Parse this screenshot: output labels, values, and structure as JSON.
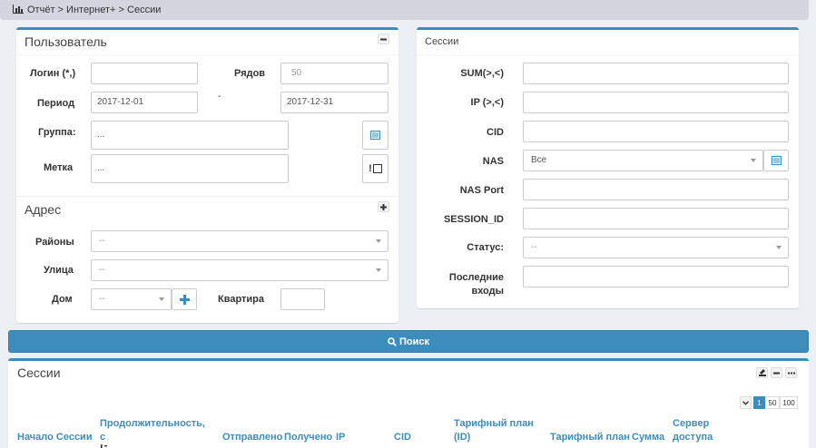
{
  "breadcrumb": {
    "items": [
      "Отчёт",
      "Интернет+",
      "Сессии"
    ],
    "sep": ">"
  },
  "user_box": {
    "title": "Пользователь",
    "login_label": "Логин (*,)",
    "login_value": "",
    "rows_label": "Рядов",
    "rows_value": "50",
    "period_label": "Период",
    "period_from": "2017-12-01",
    "period_dash": "-",
    "period_to": "2017-12-31",
    "group_label": "Группа:",
    "group_value": "...",
    "tag_label": "Метка",
    "tag_value": "..."
  },
  "address": {
    "title": "Адрес",
    "district_label": "Районы",
    "district_value": "--",
    "street_label": "Улица",
    "street_value": "--",
    "house_label": "Дом",
    "house_value": "--",
    "flat_label": "Квартира",
    "flat_value": ""
  },
  "sessions_filter": {
    "title": "Сессии",
    "sum_label": "SUM(>,<)",
    "ip_label": "IP (>,<)",
    "cid_label": "CID",
    "nas_label": "NAS",
    "nas_value": "Все",
    "nas_port_label": "NAS Port",
    "session_id_label": "SESSION_ID",
    "status_label": "Статус:",
    "status_value": "--",
    "last_logins_label_1": "Последние",
    "last_logins_label_2": "входы"
  },
  "search": {
    "label": "Поиск"
  },
  "results": {
    "title": "Сессии",
    "page_sizes": [
      "1",
      "50",
      "100"
    ],
    "active_page_size": "1",
    "columns": [
      "Начало Сессии",
      "Продолжительность, с",
      "Отправлено",
      "Получено",
      "IP",
      "CID",
      "Тарифный план (ID)",
      "Тарифный план",
      "Сумма",
      "Сервер доступа"
    ]
  },
  "icons": {
    "breadcrumb": "bar-chart-icon",
    "collapse": "minus-icon",
    "expand": "plus-icon",
    "list": "list-icon",
    "checkbox": "checkbox-icon",
    "add": "plus-icon",
    "search": "search-icon",
    "export": "export-icon",
    "more": "ellipsis-icon",
    "sort": "sort-icon",
    "chevron": "chevron-down-icon"
  },
  "colors": {
    "primary": "#3c8dbc",
    "background": "#ecf0f5",
    "breadcrumb_bg": "#d2d6de"
  }
}
